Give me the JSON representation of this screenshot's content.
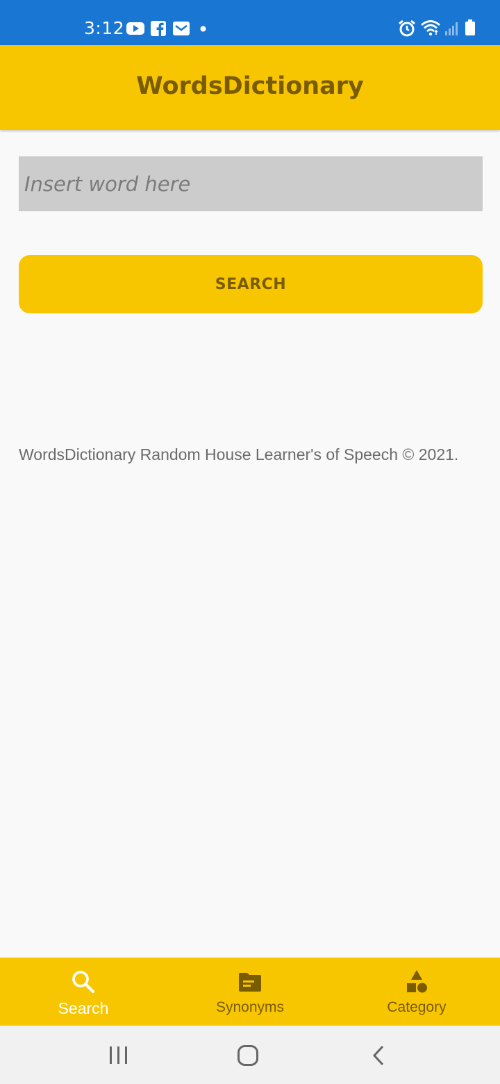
{
  "status_bar": {
    "time": "3:12",
    "left_icons": [
      "youtube-icon",
      "facebook-icon",
      "mail-icon",
      "dot-icon"
    ],
    "right_icons": [
      "alarm-icon",
      "wifi-icon",
      "signal-icon",
      "battery-icon"
    ]
  },
  "app_bar": {
    "title": "WordsDictionary"
  },
  "search": {
    "placeholder": "Insert word here",
    "value": "",
    "button_label": "SEARCH"
  },
  "footer": {
    "text": "WordsDictionary Random House Learner's of Speech © 2021."
  },
  "bottom_nav": {
    "items": [
      {
        "label": "Search",
        "icon": "search-icon",
        "active": true
      },
      {
        "label": "Synonyms",
        "icon": "folder-icon",
        "active": false
      },
      {
        "label": "Category",
        "icon": "category-icon",
        "active": false
      }
    ]
  },
  "system_nav": {
    "buttons": [
      "recents-icon",
      "home-icon",
      "back-icon"
    ]
  },
  "colors": {
    "status_bar": "#1976d2",
    "accent": "#f8c600",
    "accent_text": "#7a5c00",
    "input_bg": "#cccccc",
    "background": "#f9f9f9"
  }
}
